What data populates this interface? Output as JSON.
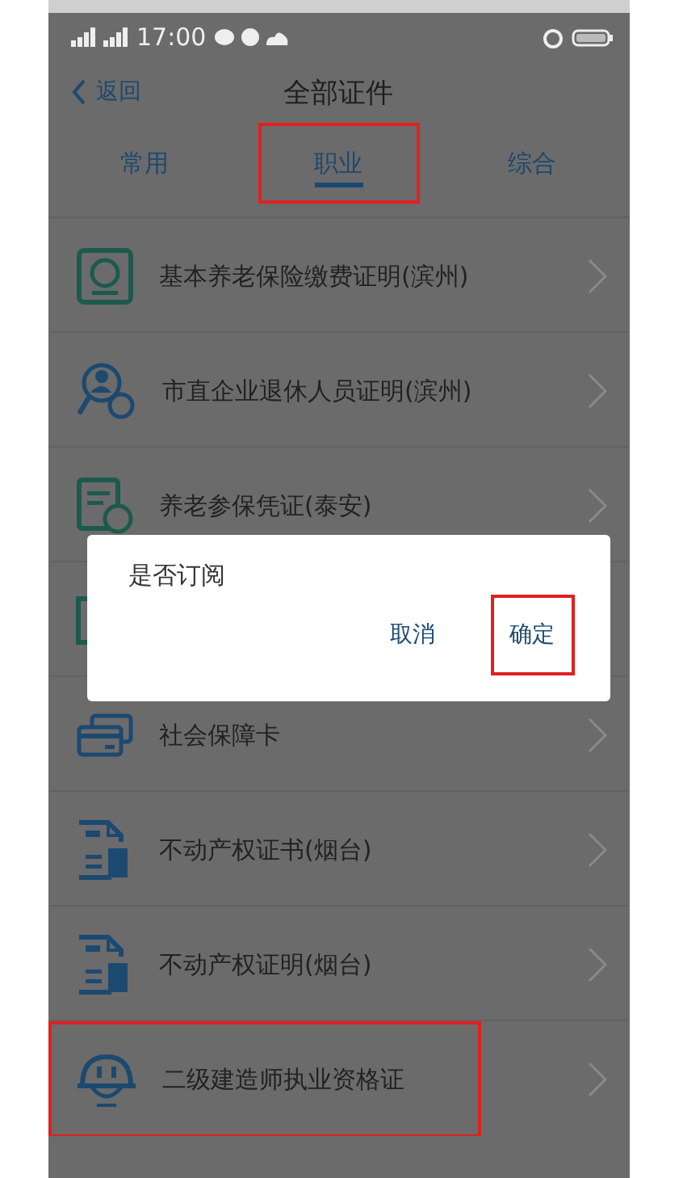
{
  "status_bar": {
    "time": "17:00"
  },
  "nav": {
    "back": "返回",
    "title": "全部证件"
  },
  "tabs": [
    {
      "label": "常用",
      "selected": false,
      "highlighted": false
    },
    {
      "label": "职业",
      "selected": true,
      "highlighted": true
    },
    {
      "label": "综合",
      "selected": false,
      "highlighted": false
    }
  ],
  "items": [
    {
      "kind": "pension",
      "label": "基本养老保险缴费证明(滨州)",
      "highlighted": false
    },
    {
      "kind": "search",
      "label": "市直企业退休人员证明(滨州)",
      "highlighted": false
    },
    {
      "kind": "form",
      "label": "养老参保凭证(泰安)",
      "highlighted": false
    },
    {
      "kind": "hidden",
      "highlighted": false
    },
    {
      "kind": "cards",
      "label": "社会保障卡",
      "highlighted": false
    },
    {
      "kind": "document",
      "label": "不动产权证书(烟台)",
      "highlighted": false
    },
    {
      "kind": "document",
      "label": "不动产权证明(烟台)",
      "highlighted": false
    },
    {
      "kind": "helmet",
      "label": "二级建造师执业资格证",
      "highlighted": true
    }
  ],
  "dialog": {
    "message": "是否订阅",
    "buttons": [
      {
        "label": "取消",
        "highlighted": false
      },
      {
        "label": "确定",
        "highlighted": true
      }
    ]
  }
}
